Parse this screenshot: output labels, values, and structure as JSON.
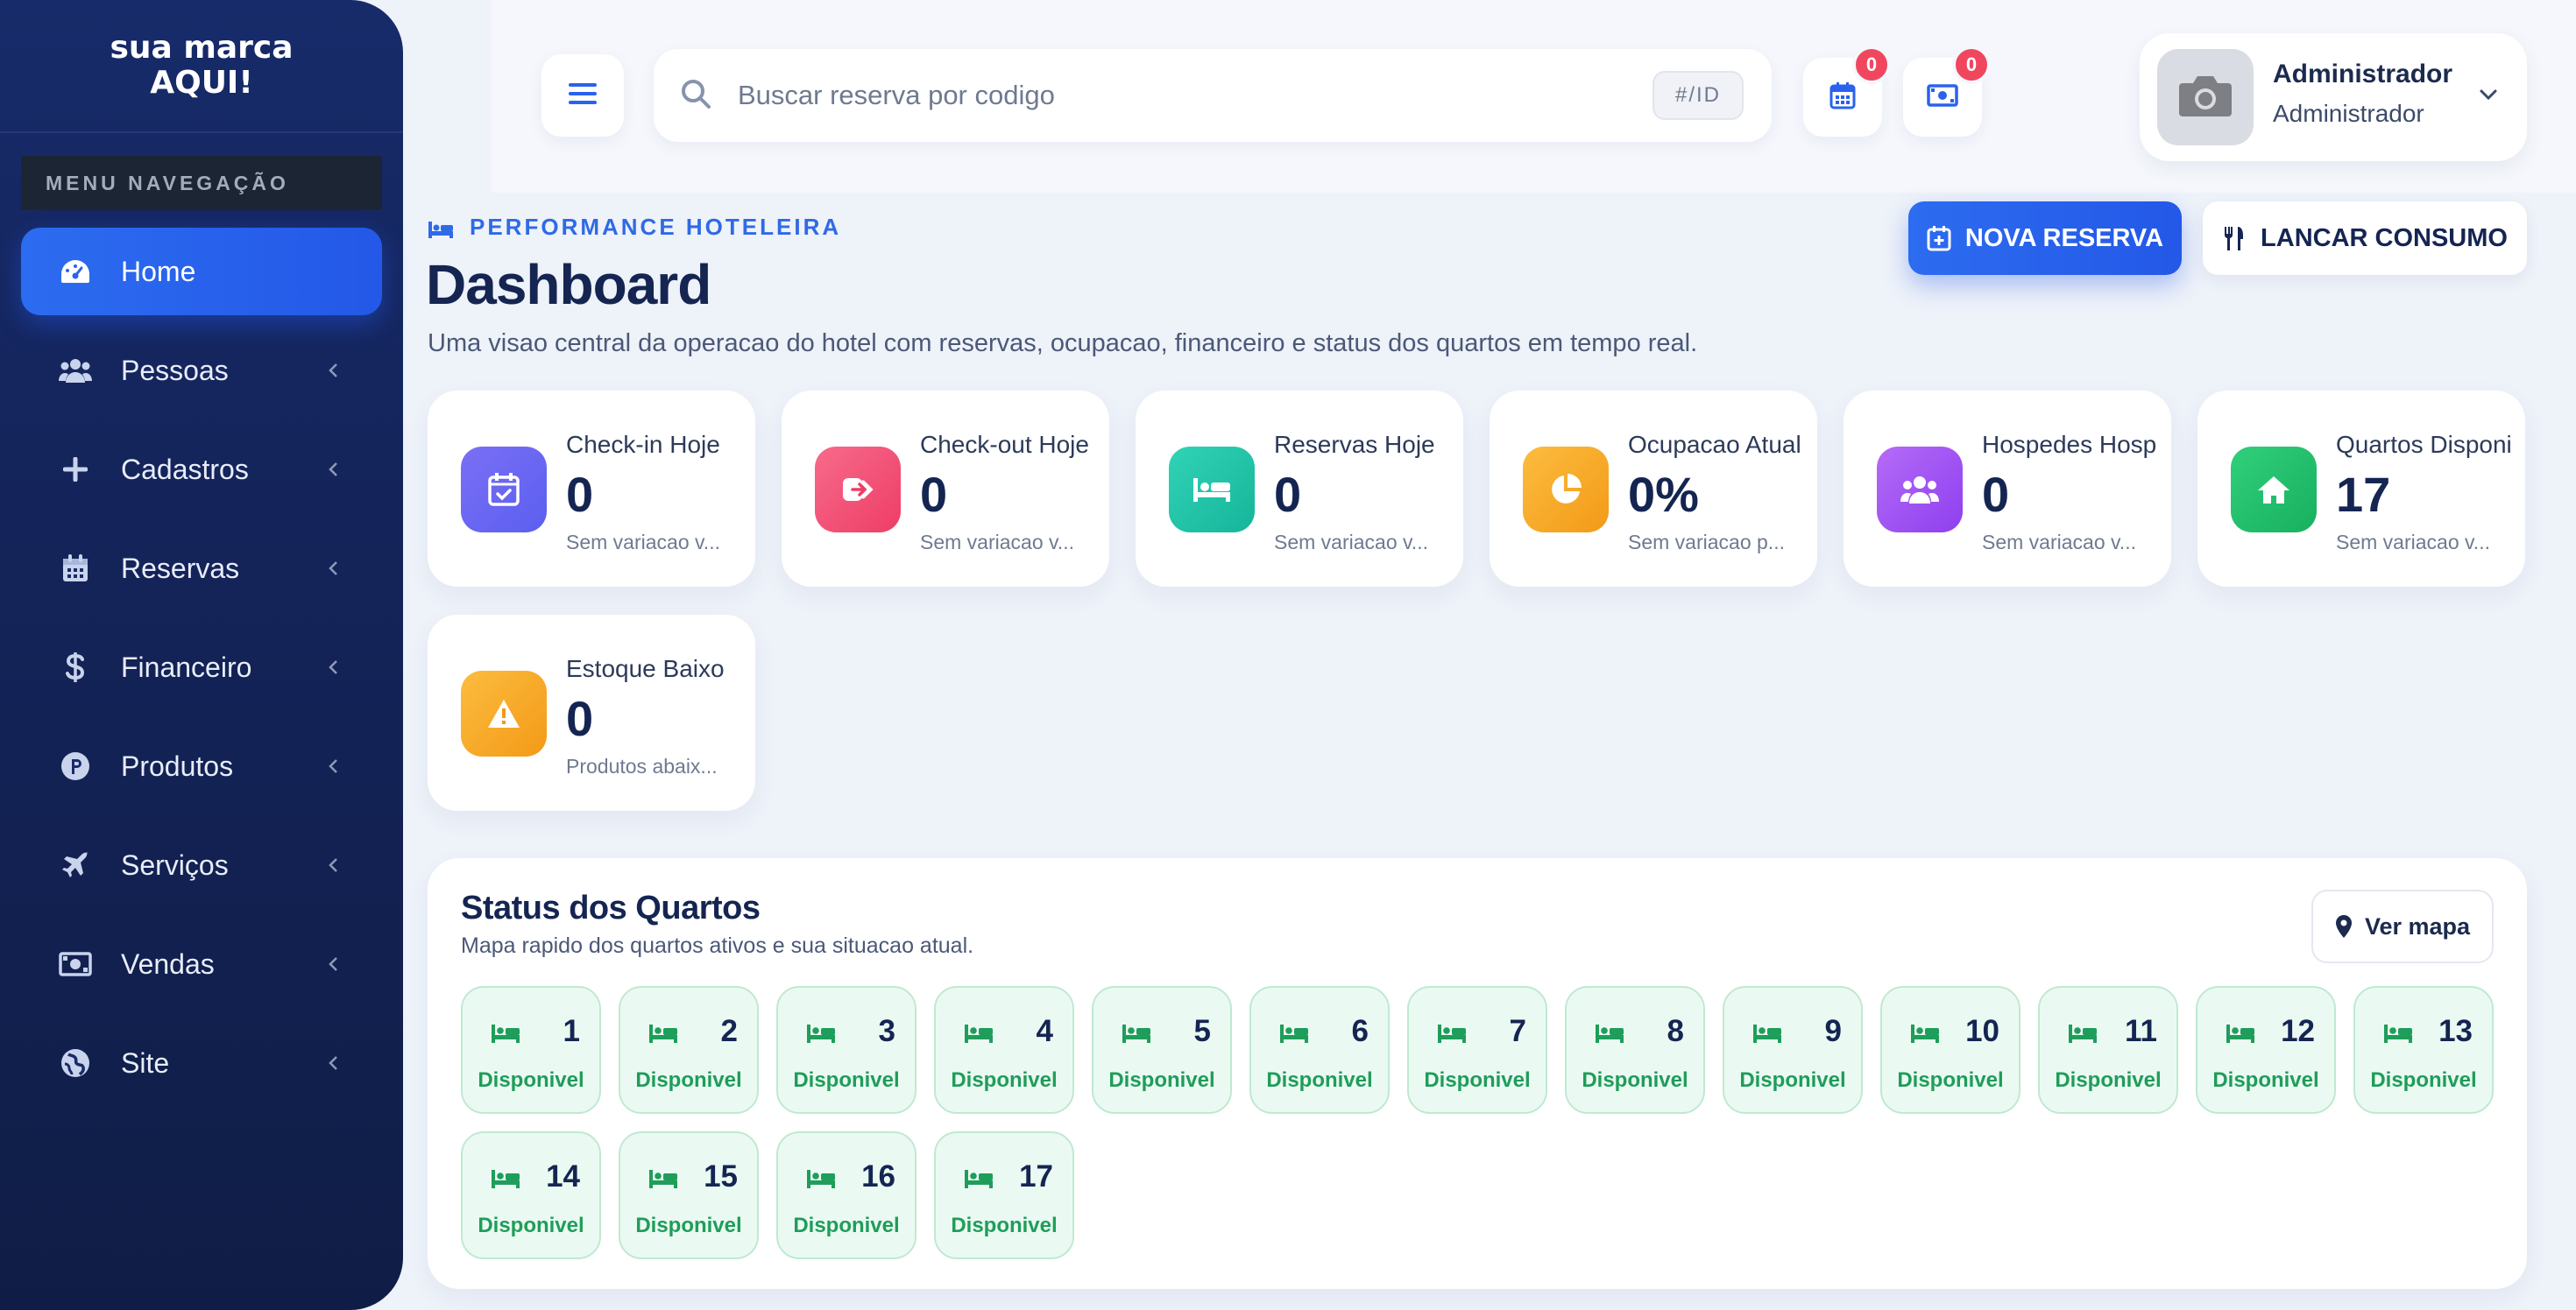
{
  "brand": {
    "line1": "sua marca",
    "line2": "AQUI!"
  },
  "sidebar": {
    "header": "MENU NAVEGAÇÃO",
    "items": [
      {
        "label": "Home",
        "icon": "dashboard-icon",
        "active": true
      },
      {
        "label": "Pessoas",
        "icon": "users-icon"
      },
      {
        "label": "Cadastros",
        "icon": "plus-icon"
      },
      {
        "label": "Reservas",
        "icon": "calendar-icon"
      },
      {
        "label": "Financeiro",
        "icon": "dollar-icon"
      },
      {
        "label": "Produtos",
        "icon": "product-p-icon"
      },
      {
        "label": "Serviços",
        "icon": "plane-icon"
      },
      {
        "label": "Vendas",
        "icon": "money-bill-icon"
      },
      {
        "label": "Site",
        "icon": "globe-icon"
      }
    ]
  },
  "topbar": {
    "search_placeholder": "Buscar reserva por codigo",
    "search_hint": "#/ID",
    "calendar_badge": "0",
    "money_badge": "0",
    "user_name": "Administrador",
    "user_role": "Administrador"
  },
  "page": {
    "kicker": "PERFORMANCE HOTELEIRA",
    "title": "Dashboard",
    "subtitle": "Uma visao central da operacao do hotel com reservas, ocupacao, financeiro e status dos quartos em tempo real.",
    "primary_button": "NOVA RESERVA",
    "secondary_button": "LANCAR CONSUMO"
  },
  "stats": [
    {
      "label": "Check-in Hoje",
      "value": "0",
      "note": "Sem variacao v...",
      "color": "#5b5ff0",
      "icon": "calendar-check-icon"
    },
    {
      "label": "Check-out Hoje",
      "value": "0",
      "note": "Sem variacao v...",
      "color": "#f0476e",
      "icon": "sign-out-icon"
    },
    {
      "label": "Reservas Hoje",
      "value": "0",
      "note": "Sem variacao v...",
      "color": "#1fbfa7",
      "icon": "bed-icon"
    },
    {
      "label": "Ocupacao Atual",
      "value": "0%",
      "note": "Sem variacao p...",
      "color": "#f7a21e",
      "icon": "pie-chart-icon"
    },
    {
      "label": "Hospedes Hospedados",
      "value": "0",
      "note": "Sem variacao v...",
      "color": "#a04ff0",
      "icon": "users-icon"
    },
    {
      "label": "Quartos Disponiveis",
      "value": "17",
      "note": "Sem variacao v...",
      "color": "#1fb865",
      "icon": "home-icon"
    },
    {
      "label": "Estoque Baixo",
      "value": "0",
      "note": "Produtos abaix...",
      "color": "#f7a21e",
      "icon": "warning-icon"
    }
  ],
  "rooms_panel": {
    "title": "Status dos Quartos",
    "subtitle": "Mapa rapido dos quartos ativos e sua situacao atual.",
    "map_button": "Ver mapa",
    "status_color": "#1f9d5a",
    "rooms": [
      {
        "number": "1",
        "status": "Disponivel"
      },
      {
        "number": "2",
        "status": "Disponivel"
      },
      {
        "number": "3",
        "status": "Disponivel"
      },
      {
        "number": "4",
        "status": "Disponivel"
      },
      {
        "number": "5",
        "status": "Disponivel"
      },
      {
        "number": "6",
        "status": "Disponivel"
      },
      {
        "number": "7",
        "status": "Disponivel"
      },
      {
        "number": "8",
        "status": "Disponivel"
      },
      {
        "number": "9",
        "status": "Disponivel"
      },
      {
        "number": "10",
        "status": "Disponivel"
      },
      {
        "number": "11",
        "status": "Disponivel"
      },
      {
        "number": "12",
        "status": "Disponivel"
      },
      {
        "number": "13",
        "status": "Disponivel"
      },
      {
        "number": "14",
        "status": "Disponivel"
      },
      {
        "number": "15",
        "status": "Disponivel"
      },
      {
        "number": "16",
        "status": "Disponivel"
      },
      {
        "number": "17",
        "status": "Disponivel"
      }
    ]
  }
}
